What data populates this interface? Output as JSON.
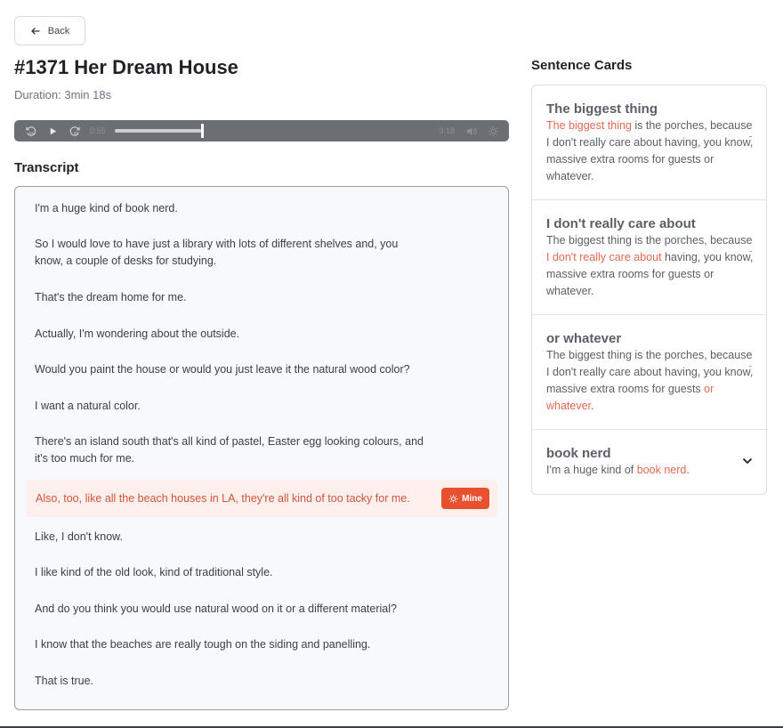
{
  "back": {
    "label": "Back"
  },
  "episode": {
    "title": "#1371 Her Dream House",
    "duration": "Duration: 3min 18s"
  },
  "player": {
    "current_time": "0:55",
    "total_time": "3:18",
    "progress": 0.278
  },
  "transcript": {
    "heading": "Transcript",
    "lines": [
      "I'm a huge kind of book nerd.",
      "So I would love to have just a library with lots of different shelves and, you know, a couple of desks for studying.",
      "That's the dream home for me.",
      "Actually, I'm wondering about the outside.",
      "Would you paint the house or would you just leave it the natural wood color?",
      "I want a natural color.",
      "There's an island south that's all kind of pastel, Easter egg looking colours, and it's too much for me.",
      "Also, too, like all the beach houses in LA, they're all kind of too tacky for me.",
      "Like, I don't know.",
      "I like kind of the old look, kind of traditional style.",
      "And do you think you would use natural wood on it or a different material?",
      "I know that the beaches are really tough on the siding and panelling.",
      "That is true."
    ],
    "mine_label": "Mine"
  },
  "cards": {
    "heading": "Sentence Cards",
    "items": [
      {
        "title": "The biggest thing",
        "before": "",
        "highlight": "The biggest thing",
        "after": " is the porches, because I don't really care about having, you know, massive extra rooms for guests or whatever."
      },
      {
        "title": "I don't really care about",
        "before": "The biggest thing is the porches, because ",
        "highlight": "I don't really care about",
        "after": " having, you know, massive extra rooms for guests or whatever."
      },
      {
        "title": "or whatever",
        "before": "The biggest thing is the porches, because I don't really care about having, you know, massive extra rooms for guests ",
        "highlight": "or whatever",
        "after": "."
      },
      {
        "title": "book nerd",
        "before": "I'm a huge kind of ",
        "highlight": "book nerd",
        "after": "."
      }
    ]
  },
  "colors": {
    "accent": "#e8502f",
    "highlight_text": "#e06a52",
    "highlight_bg": "#fdf0ec",
    "player_bg": "#6b6f74"
  },
  "icons": {
    "back": "arrow-left-icon",
    "rewind": "rewind-15-icon",
    "play": "play-icon",
    "forward": "forward-15-icon",
    "volume": "volume-icon",
    "settings": "gear-icon",
    "mine": "sun-icon",
    "expand": "chevron-down-icon"
  }
}
